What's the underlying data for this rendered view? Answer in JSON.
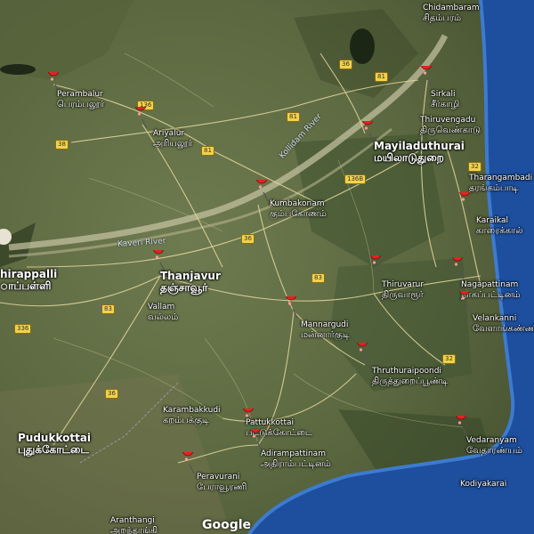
{
  "map": {
    "attribution": "Google",
    "rivers": [
      {
        "id": "kollidam",
        "name": "Kollidam River"
      },
      {
        "id": "kaveri",
        "name": "Kaveri River"
      }
    ],
    "places": [
      {
        "id": "chidambaram",
        "en": "Chidambaram",
        "ta": "சிதம்பரம்",
        "pin": false
      },
      {
        "id": "perambalur",
        "en": "Perambalur",
        "ta": "பெரம்பலூர்",
        "pin": true
      },
      {
        "id": "ariyalur",
        "en": "Ariyalur",
        "ta": "அரியலூர்",
        "pin": true
      },
      {
        "id": "sirkali",
        "en": "Sirkali",
        "ta": "சீர்காழி",
        "pin": true
      },
      {
        "id": "thiruvengadu",
        "en": "Thiruvengadu",
        "ta": "திருவெண்காடு",
        "pin": false
      },
      {
        "id": "mayiladuthurai",
        "en": "Mayiladuthurai",
        "ta": "மயிலாடுதுறை",
        "pin": true
      },
      {
        "id": "tharangambadi",
        "en": "Tharangambadi",
        "ta": "தரங்கம்பாடி",
        "pin": false
      },
      {
        "id": "kumbakonam",
        "en": "Kumbakonam",
        "ta": "கும்பகோணம்",
        "pin": true
      },
      {
        "id": "karaikal",
        "en": "Karaikal",
        "ta": "காரைக்கால்",
        "pin": true
      },
      {
        "id": "tiruchirappalli",
        "en": "hirappalli",
        "ta": "ாப்பள்ளி",
        "pin": false
      },
      {
        "id": "thanjavur",
        "en": "Thanjavur",
        "ta": "தஞ்சாவூர்",
        "pin": true
      },
      {
        "id": "thiruvarur",
        "en": "Thiruvarur",
        "ta": "திருவாரூர்",
        "pin": true
      },
      {
        "id": "nagapattinam",
        "en": "Nagapattinam",
        "ta": "நாகப்பட்டினம்",
        "pin": true
      },
      {
        "id": "vallam",
        "en": "Vallam",
        "ta": "வல்லம்",
        "pin": false
      },
      {
        "id": "mannargudi",
        "en": "Mannargudi",
        "ta": "மன்னார்குடி",
        "pin": true
      },
      {
        "id": "velankanni",
        "en": "Velankanni",
        "ta": "வேளாங்கண்ணி",
        "pin": true
      },
      {
        "id": "thiruthuraipoondi",
        "en": "Thruthuraipoondi",
        "ta": "திருத்துறைப்பூண்டி",
        "pin": true
      },
      {
        "id": "karambakkudi",
        "en": "Karambakkudi",
        "ta": "கறம்பக்குடி",
        "pin": false
      },
      {
        "id": "pattukkottai",
        "en": "Pattukkottai",
        "ta": "பட்டுக்கோட்டை",
        "pin": true
      },
      {
        "id": "pudukkottai",
        "en": "Pudukkottai",
        "ta": "புதுக்கோட்டை",
        "pin": false
      },
      {
        "id": "adirampattinam",
        "en": "Adirampattinam",
        "ta": "அதிராம்பட்டினம்",
        "pin": true
      },
      {
        "id": "vedaranyam",
        "en": "Vedaranyam",
        "ta": "வேதாரண்யம்",
        "pin": true
      },
      {
        "id": "peravurani",
        "en": "Peravurani",
        "ta": "பேராவூரணி",
        "pin": true
      },
      {
        "id": "kodiyakarai",
        "en": "Kodiyakarai",
        "ta": "",
        "pin": false
      },
      {
        "id": "aranthangi",
        "en": "Aranthangi",
        "ta": "அறந்தாங்கி",
        "pin": false
      }
    ],
    "road_shields": [
      "36",
      "81",
      "136",
      "38",
      "81",
      "81",
      "136B",
      "32",
      "36",
      "83",
      "83",
      "336",
      "32",
      "36"
    ]
  }
}
